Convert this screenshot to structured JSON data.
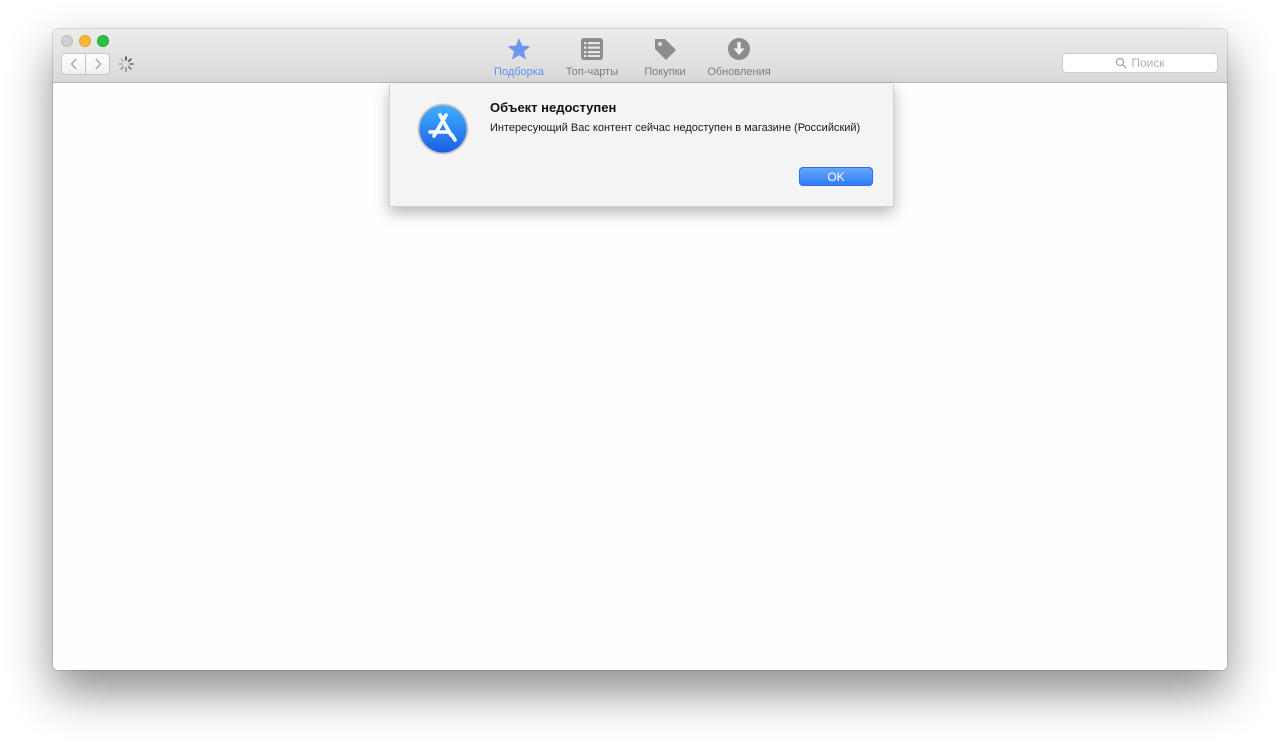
{
  "toolbar": {
    "tabs": [
      {
        "label": "Подборка",
        "icon": "star-icon",
        "active": true
      },
      {
        "label": "Топ-чарты",
        "icon": "list-icon",
        "active": false
      },
      {
        "label": "Покупки",
        "icon": "tag-icon",
        "active": false
      },
      {
        "label": "Обновления",
        "icon": "download-icon",
        "active": false
      }
    ],
    "search": {
      "placeholder": "Поиск"
    }
  },
  "dialog": {
    "title": "Объект недоступен",
    "message": "Интересующий Вас контент сейчас недоступен в магазине (Российский)",
    "ok_label": "OK",
    "icon": "app-store-icon"
  },
  "colors": {
    "accent": "#5e8df0",
    "ok_button": "#3a86f7",
    "close": "#d0d0d0",
    "minimize": "#f5b83a",
    "maximize": "#29c440"
  }
}
